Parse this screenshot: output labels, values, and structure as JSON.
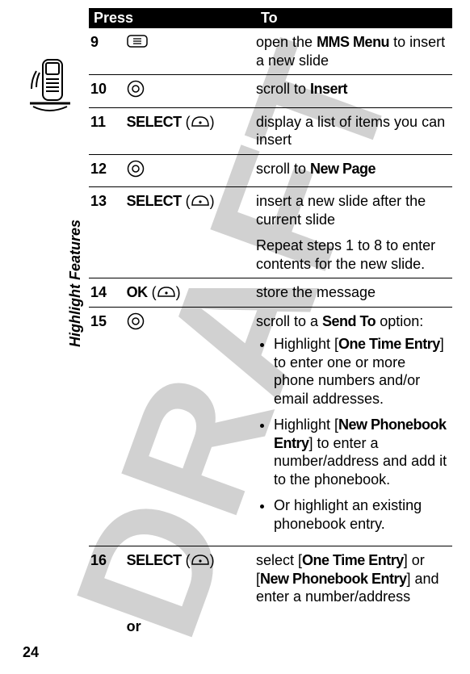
{
  "page_number": "24",
  "section": "Highlight Features",
  "watermark": "DRAFT",
  "table": {
    "header": {
      "press": "Press",
      "to": "To"
    },
    "rows": {
      "r9": {
        "num": "9",
        "key": "menu",
        "to_parts": [
          [
            "open the "
          ],
          [
            "bold",
            "MMS Menu"
          ],
          [
            " to insert a new slide"
          ]
        ]
      },
      "r10": {
        "num": "10",
        "key": "nav",
        "to_parts": [
          [
            "scroll to "
          ],
          [
            "bold",
            "Insert"
          ]
        ]
      },
      "r11": {
        "num": "11",
        "key": "soft",
        "label": "SELECT",
        "to_parts": [
          [
            "display a list of items you can insert"
          ]
        ]
      },
      "r12": {
        "num": "12",
        "key": "nav",
        "to_parts": [
          [
            "scroll to "
          ],
          [
            "bold",
            "New Page"
          ]
        ]
      },
      "r13": {
        "num": "13",
        "key": "soft",
        "label": "SELECT",
        "to_parts": [
          [
            "insert a new slide after the current slide"
          ]
        ],
        "extra": "Repeat steps 1 to 8 to enter contents for the new slide."
      },
      "r14": {
        "num": "14",
        "key": "soft",
        "label": "OK",
        "to_parts": [
          [
            "store the message"
          ]
        ]
      },
      "r15": {
        "num": "15",
        "key": "nav",
        "to_parts": [
          [
            "scroll to a "
          ],
          [
            "bold",
            "Send To"
          ],
          [
            " option:"
          ]
        ],
        "bullets": [
          [
            [
              "Highlight ["
            ],
            [
              "bold",
              "One Time Entry"
            ],
            [
              "] to enter one or more phone numbers and/or email addresses."
            ]
          ],
          [
            [
              "Highlight ["
            ],
            [
              "bold",
              "New Phonebook Entry"
            ],
            [
              "] to enter a number/address and add it to the phonebook."
            ]
          ],
          [
            [
              "Or highlight an existing phonebook entry."
            ]
          ]
        ]
      },
      "r16": {
        "num": "16",
        "key": "soft",
        "label": "SELECT",
        "to_parts": [
          [
            "select ["
          ],
          [
            "bold",
            "One Time Entry"
          ],
          [
            "] or ["
          ],
          [
            "bold",
            "New Phonebook Entry"
          ],
          [
            "] and enter a number/address"
          ]
        ]
      },
      "or_label": "or"
    }
  }
}
